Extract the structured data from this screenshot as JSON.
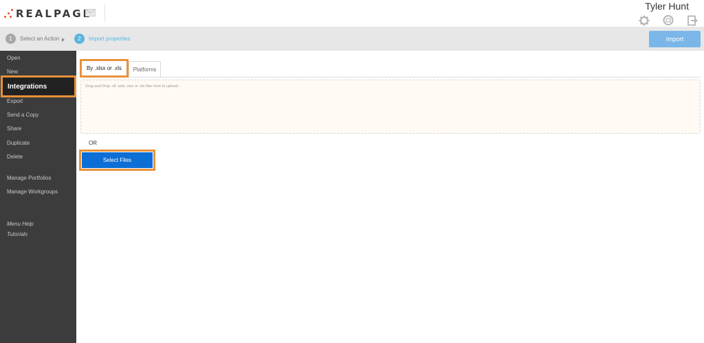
{
  "header": {
    "logo_text": "REALPAGE",
    "logo_tm": "®",
    "user_name": "Tyler Hunt",
    "icons": [
      "mail-icon",
      "gear-icon",
      "chat-icon",
      "logout-icon"
    ]
  },
  "steps": [
    {
      "num": "1",
      "label": "Select an Action"
    },
    {
      "num": "2",
      "label": "Import properties"
    }
  ],
  "toolbar": {
    "import_label": "Import"
  },
  "sidebar": {
    "items": [
      {
        "label": "Open"
      },
      {
        "label": "New"
      },
      {
        "label": "Integrations"
      },
      {
        "label": "Export"
      },
      {
        "label": "Send a Copy"
      },
      {
        "label": "Share"
      },
      {
        "label": "Duplicate"
      },
      {
        "label": "Delete"
      },
      {
        "label": "Manage Portfolios"
      },
      {
        "label": "Manage Workgroups"
      },
      {
        "label": "Menu Help"
      },
      {
        "label": "Tutorials"
      }
    ]
  },
  "tabs": [
    {
      "label": "By .xlsx or .xls"
    },
    {
      "label": "Platforms"
    }
  ],
  "dropzone": {
    "text": "Drag and Drop .sif .aelx .xlsx or .xls files here to upload..."
  },
  "or_text": "OR",
  "select_files_label": "Select Files",
  "colors": {
    "accent": "#e8913a",
    "primary": "#0d6fd5",
    "import_button": "#7ab6e8",
    "sidebar": "#3c3c3c",
    "step_active": "#5ab4dd",
    "logo": "#e2522a"
  }
}
